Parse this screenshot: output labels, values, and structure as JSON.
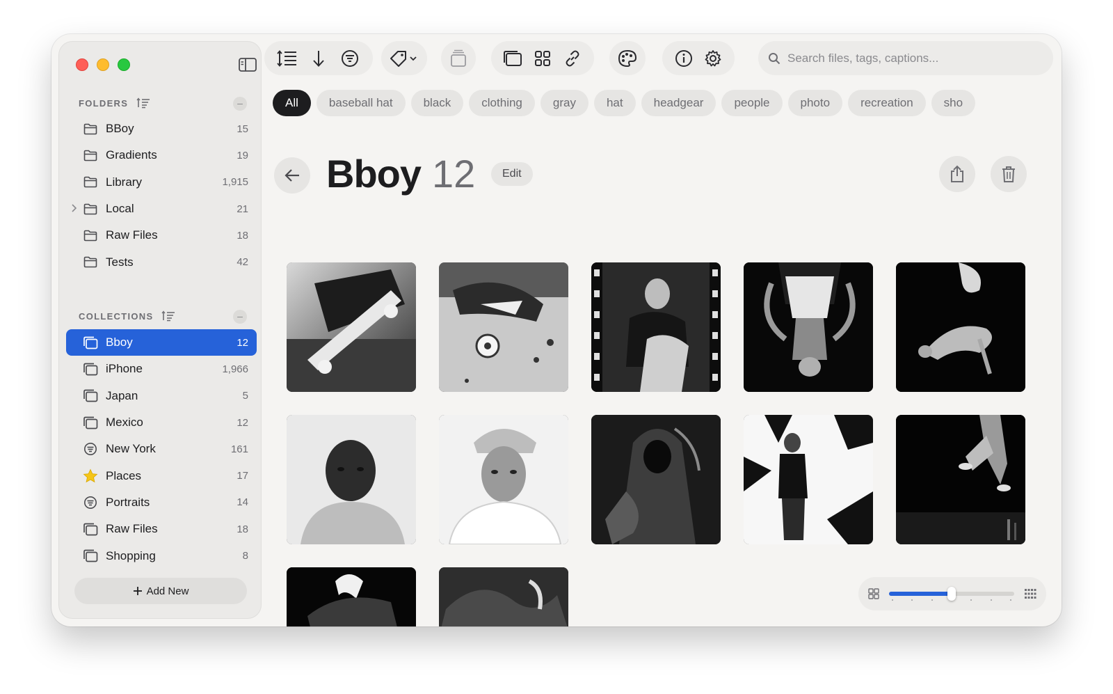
{
  "sidebar": {
    "folders_title": "FOLDERS",
    "folders": [
      {
        "label": "BBoy",
        "count": "15",
        "icon": "folder-icon"
      },
      {
        "label": "Gradients",
        "count": "19",
        "icon": "folder-icon"
      },
      {
        "label": "Library",
        "count": "1,915",
        "icon": "folder-icon"
      },
      {
        "label": "Local",
        "count": "21",
        "icon": "folder-icon",
        "expandable": true
      },
      {
        "label": "Raw Files",
        "count": "18",
        "icon": "folder-icon"
      },
      {
        "label": "Tests",
        "count": "42",
        "icon": "folder-icon"
      }
    ],
    "collections_title": "COLLECTIONS",
    "collections": [
      {
        "label": "Bboy",
        "count": "12",
        "icon": "collection-icon",
        "selected": true
      },
      {
        "label": "iPhone",
        "count": "1,966",
        "icon": "collection-icon"
      },
      {
        "label": "Japan",
        "count": "5",
        "icon": "collection-icon"
      },
      {
        "label": "Mexico",
        "count": "12",
        "icon": "collection-icon"
      },
      {
        "label": "New York",
        "count": "161",
        "icon": "smart-collection-icon"
      },
      {
        "label": "Places",
        "count": "17",
        "icon": "star-icon"
      },
      {
        "label": "Portraits",
        "count": "14",
        "icon": "smart-collection-icon"
      },
      {
        "label": "Raw Files",
        "count": "18",
        "icon": "collection-icon"
      },
      {
        "label": "Shopping",
        "count": "8",
        "icon": "collection-icon"
      }
    ],
    "add_new_label": "Add New"
  },
  "search": {
    "placeholder": "Search files, tags, captions..."
  },
  "tags": [
    "All",
    "baseball hat",
    "black",
    "clothing",
    "gray",
    "hat",
    "headgear",
    "people",
    "photo",
    "recreation",
    "sho"
  ],
  "header": {
    "title": "Bboy",
    "count": "12",
    "edit_label": "Edit"
  },
  "colors": {
    "accent": "#2662d9",
    "window_bg": "#f5f4f2",
    "sidebar_bg": "#ebeae8"
  },
  "zoom": {
    "level": 0.5
  }
}
